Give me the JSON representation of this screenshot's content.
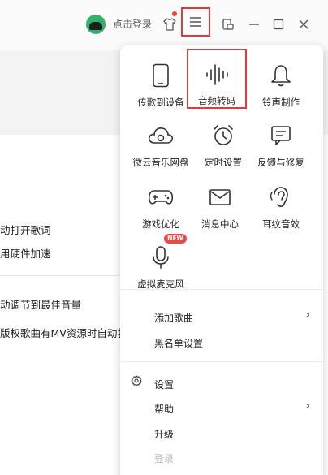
{
  "header": {
    "login_text": "点击登录"
  },
  "background": {
    "lines": [
      "动打开歌词",
      "用硬件加速",
      "动调节到最佳音量",
      "版权歌曲有MV资源时自动扌"
    ]
  },
  "menu": {
    "tiles": [
      {
        "label": "传歌到设备",
        "icon": "phone-icon"
      },
      {
        "label": "音频转码",
        "icon": "audio-waveform-icon"
      },
      {
        "label": "铃声制作",
        "icon": "bell-icon"
      },
      {
        "label": "微云音乐网盘",
        "icon": "cloud-icon"
      },
      {
        "label": "定时设置",
        "icon": "alarm-clock-icon"
      },
      {
        "label": "反馈与修复",
        "icon": "feedback-icon"
      },
      {
        "label": "游戏优化",
        "icon": "gamepad-icon"
      },
      {
        "label": "消息中心",
        "icon": "mail-icon"
      },
      {
        "label": "耳纹音效",
        "icon": "ear-icon"
      },
      {
        "label": "虚拟麦克风",
        "icon": "microphone-icon"
      }
    ],
    "new_badge": "NEW",
    "list": [
      {
        "label": "添加歌曲",
        "has_submenu": true
      },
      {
        "label": "黑名单设置",
        "has_submenu": false
      },
      {
        "label": "设置",
        "has_submenu": false
      },
      {
        "label": "帮助",
        "has_submenu": true
      },
      {
        "label": "升级",
        "has_submenu": false
      },
      {
        "label": "登录",
        "has_submenu": false,
        "disabled": true
      }
    ],
    "chevron": "›"
  },
  "colors": {
    "highlight_border": "#e03b3b",
    "badge": "#e84a4a",
    "avatar": "#2fb36a"
  }
}
